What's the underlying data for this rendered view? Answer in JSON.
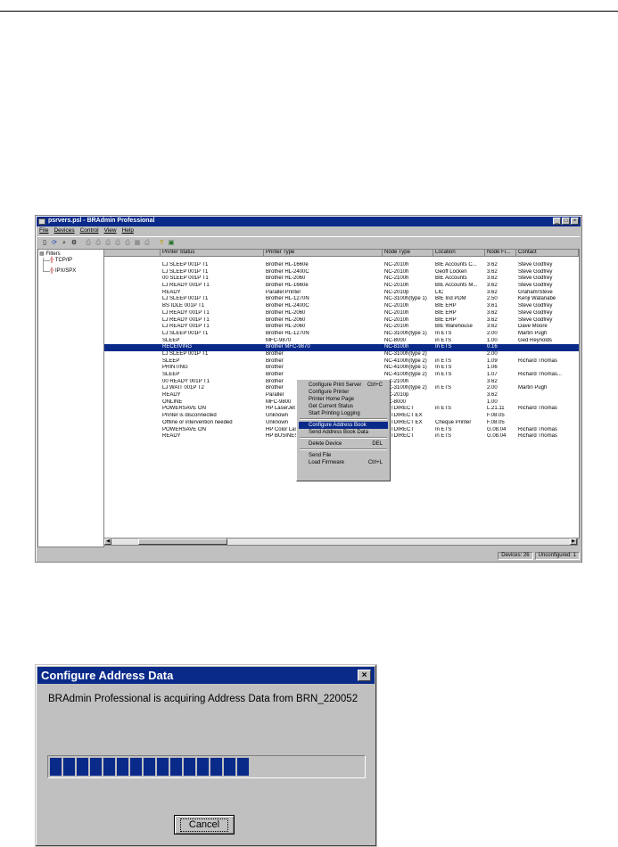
{
  "bradmin": {
    "title": "psrvers.psl - BRAdmin Professional",
    "menu": [
      "File",
      "Devices",
      "Control",
      "View",
      "Help"
    ],
    "toolbar_icons": [
      "open-icon",
      "refresh-icon",
      "search-icon",
      "config-icon",
      "printer-icon",
      "printer-icon",
      "printer-icon",
      "printer-icon",
      "printer-icon",
      "grid-icon",
      "printer-icon",
      "help-icon",
      "window-icon"
    ],
    "tree": {
      "root": "Filters",
      "items": [
        "TCP/IP",
        "IPX/SPX"
      ]
    },
    "columns": [
      "",
      "Printer Status",
      "Printer Type",
      "Node Type",
      "Location",
      "Node Fi...",
      "Contact"
    ],
    "rows": [
      [
        "LJ SLEEP 001P T1",
        "Brother HL-1660e",
        "NC-2010h",
        "BIE Accounts C...",
        "3.62",
        "Steve Godfrey"
      ],
      [
        "LJ SLEEP 001P T1",
        "Brother HL-2400C",
        "NC-2010h",
        "Geoff Locken",
        "3.62",
        "Steve Godfrey"
      ],
      [
        "00 SLEEP 001P T1",
        "Brother HL-2060",
        "NC-2100h",
        "BIE Accounts",
        "3.62",
        "Steve Godfrey"
      ],
      [
        "LJ READY 001P T1",
        "Brother HL-1660e",
        "NC-2010h",
        "BIE Accounts M...",
        "3.62",
        "Steve Godfrey"
      ],
      [
        "READY",
        "Parallel Printer",
        "NC-2010p",
        "LIC",
        "3.62",
        "Graham/Steve"
      ],
      [
        "LJ SLEEP 001P T1",
        "Brother HL-1270N",
        "NC-3100h(type 1)",
        "BIE Ind PDM",
        "2.50",
        "Kenji Watanabe"
      ],
      [
        "BS IDLE 001P T1",
        "Brother HL-2400C",
        "NC-2010h",
        "BIE ERP",
        "3.61",
        "Steve Godfrey"
      ],
      [
        "LJ READY 001P T1",
        "Brother HL-2060",
        "NC-2010h",
        "BIE ERP",
        "3.62",
        "Steve Godfrey"
      ],
      [
        "LJ READY 001P T1",
        "Brother HL-2060",
        "NC-2010h",
        "BIE ERP",
        "3.62",
        "Steve Godfrey"
      ],
      [
        "LJ READY 001P T1",
        "Brother HL-2060",
        "NC-2010h",
        "BIE Warehouse",
        "3.62",
        "Dave Moore"
      ],
      [
        "LJ SLEEP 001P T1",
        "Brother HL-1270N",
        "NC-3100h(type 1)",
        "In ETS",
        "2.00",
        "Martin Pugh"
      ],
      [
        "SLEEP",
        "MFC-9870",
        "NC-8000",
        "in ETS",
        "1.00",
        "Ged Reynolds"
      ],
      [
        "RECEIVING",
        "Brother MFC-9870",
        "NC-8100h",
        "In ETS",
        "0.16",
        ""
      ],
      [
        "LJ SLEEP 001P T1",
        "Brother",
        "NC-3100h(type 2)",
        "",
        "2.00",
        ""
      ],
      [
        "SLEEP",
        "Brother",
        "NC-4100h(type 2)",
        "in ETS",
        "1.09",
        "Richard Thomas"
      ],
      [
        "PRINTING",
        "Brother",
        "NC-4100h(type 1)",
        "In ETS",
        "1.06",
        ""
      ],
      [
        "SLEEP",
        "Brother",
        "NC-4100h(type 2)",
        "In ETS",
        "1.07",
        "Richard Thomas..."
      ],
      [
        "00 READY 001P T1",
        "Brother",
        "NC-2100h",
        "",
        "3.62",
        ""
      ],
      [
        "LJ WAIT 001P T2",
        "Brother",
        "NC-3100h(type 2)",
        "in ETS",
        "2.00",
        "Martin Pugh"
      ],
      [
        "READY",
        "Parallel",
        "NC-2010p",
        "",
        "3.62",
        ""
      ],
      [
        "ONLINE",
        "MFC-9800",
        "NC-8000",
        "",
        "1.00",
        ""
      ],
      [
        "POWERSAVE ON",
        "HP LaserJet",
        "JETDIRECT",
        "in ETS",
        "L.21.11",
        "Richard Thomas"
      ],
      [
        "Printer is disconnected",
        "Unknown",
        "JETDIRECT EX",
        "",
        "F.08.05",
        ""
      ],
      [
        "Offline or intervention needed",
        "Unknown",
        "JETDIRECT EX",
        "Cheque Printer",
        "F.08.05",
        ""
      ],
      [
        "POWERSAVE ON",
        "HP Color LaserJet 4500",
        "JETDIRECT",
        "In ETS",
        "G.08.04",
        "Richard Thomas"
      ],
      [
        "READY",
        "HP BUSINESS INKJET 2250",
        "JETDIRECT",
        "in ETS",
        "G.08.04",
        "Richard Thomas"
      ]
    ],
    "context_menu": [
      {
        "label": "Configure Print Server",
        "shortcut": "Ctrl+C"
      },
      {
        "label": "Configure Printer",
        "shortcut": ""
      },
      {
        "label": "Printer Home Page",
        "shortcut": ""
      },
      {
        "label": "Get Current Status",
        "shortcut": ""
      },
      {
        "label": "Start Printing Logging",
        "shortcut": ""
      },
      {
        "label": "Configure Address Book",
        "shortcut": ""
      },
      {
        "label": "Send Address Book Data",
        "shortcut": ""
      },
      {
        "label": "Delete Device",
        "shortcut": "DEL"
      },
      {
        "label": "Send File",
        "shortcut": ""
      },
      {
        "label": "Load Firmware",
        "shortcut": "Ctrl+L"
      }
    ],
    "status": {
      "devices": "Devices: 26",
      "unconfigured": "Unconfigured: 1"
    }
  },
  "dialog": {
    "title": "Configure Address Data",
    "message": "BRAdmin Professional is acquiring Address Data from BRN_220052",
    "progress_fraction": 0.62,
    "cancel_label": "Cancel"
  },
  "colors": {
    "title_bar": "#0a2a8a",
    "progress": "#0a2a8a",
    "face": "#c0c0c0"
  }
}
